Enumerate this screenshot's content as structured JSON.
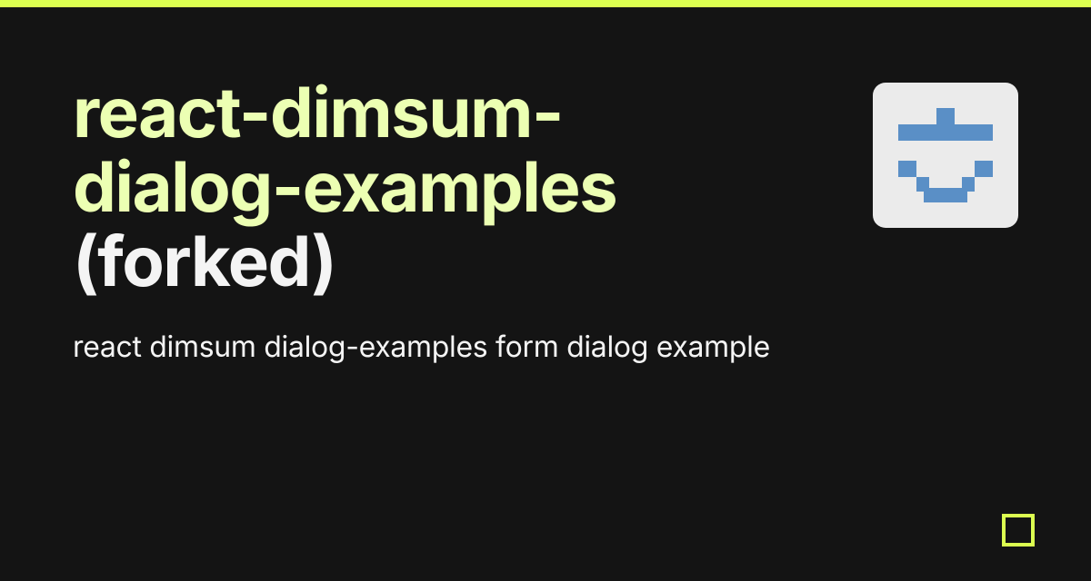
{
  "colors": {
    "accent": "#dcff50",
    "background": "#141414",
    "titleHighlight": "#ecffb3",
    "textPrimary": "#f4f4f4",
    "thumbnailBg": "#ebebeb",
    "thumbnailIcon": "#5a8fc6"
  },
  "project": {
    "name": "react-dimsum-dialog-examples",
    "suffix": " (forked)",
    "description": "react dimsum dialog-examples form dialog example"
  },
  "icon": {
    "name": "project-thumbnail-icon"
  }
}
